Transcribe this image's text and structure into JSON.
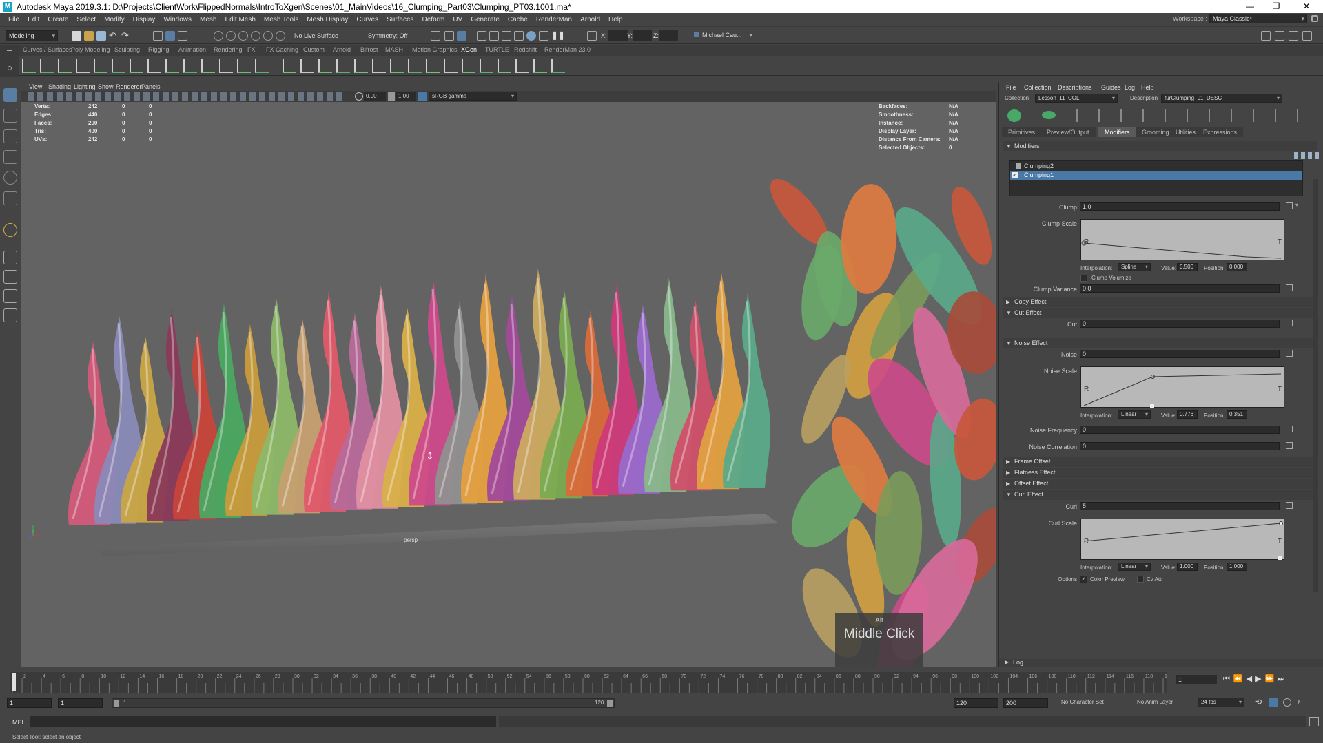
{
  "window": {
    "title": "Autodesk Maya 2019.3.1: D:\\Projects\\ClientWork\\FlippedNormals\\IntroToXgen\\Scenes\\01_MainVideos\\16_Clumping_Part03\\Clumping_PT03.1001.ma*",
    "logo_letter": "M",
    "minimize": "—",
    "maximize": "❐",
    "close": "✕"
  },
  "menubar": [
    "File",
    "Edit",
    "Create",
    "Select",
    "Modify",
    "Display",
    "Windows",
    "Mesh",
    "Edit Mesh",
    "Mesh Tools",
    "Mesh Display",
    "Curves",
    "Surfaces",
    "Deform",
    "UV",
    "Generate",
    "Cache",
    "RenderMan",
    "Arnold",
    "Help"
  ],
  "workspace": {
    "label": "Workspace :",
    "value": "Maya Classic*"
  },
  "statusline": {
    "menuset": "Modeling",
    "live_surface": "No Live Surface",
    "symmetry": "Symmetry: Off",
    "x_label": "X:",
    "y_label": "Y:",
    "z_label": "Z:",
    "user": "Michael Cau..."
  },
  "shelf_tabs": [
    "Curves / Surfaces",
    "Poly Modeling",
    "Sculpting",
    "Rigging",
    "Animation",
    "Rendering",
    "FX",
    "FX Caching",
    "Custom",
    "Arnold",
    "Bifrost",
    "MASH",
    "Motion Graphics",
    "XGen",
    "TURTLE",
    "Redshift",
    "RenderMan 23.0"
  ],
  "shelf_active_tab": "XGen",
  "panel_menu": [
    "View",
    "Shading",
    "Lighting",
    "Show",
    "Renderer",
    "Panels"
  ],
  "panel_tools": {
    "exposure": "0.00",
    "gamma": "1.00",
    "colorspace": "sRGB gamma"
  },
  "hud_left": {
    "rows": [
      {
        "label": "Verts:",
        "v1": "242",
        "v2": "0",
        "v3": "0"
      },
      {
        "label": "Edges:",
        "v1": "440",
        "v2": "0",
        "v3": "0"
      },
      {
        "label": "Faces:",
        "v1": "200",
        "v2": "0",
        "v3": "0"
      },
      {
        "label": "Tris:",
        "v1": "400",
        "v2": "0",
        "v3": "0"
      },
      {
        "label": "UVs:",
        "v1": "242",
        "v2": "0",
        "v3": "0"
      }
    ]
  },
  "hud_right": {
    "rows": [
      {
        "label": "Backfaces:",
        "value": "N/A"
      },
      {
        "label": "Smoothness:",
        "value": "N/A"
      },
      {
        "label": "Instance:",
        "value": "N/A"
      },
      {
        "label": "Display Layer:",
        "value": "N/A"
      },
      {
        "label": "Distance From Camera:",
        "value": "N/A"
      },
      {
        "label": "Selected Objects:",
        "value": "0"
      }
    ]
  },
  "viewport": {
    "camera": "persp"
  },
  "overlay": {
    "modifier": "Alt",
    "action": "Middle Click"
  },
  "xgen": {
    "menu": [
      "File",
      "Collection",
      "Descriptions",
      "Guides",
      "Log",
      "Help"
    ],
    "collection_label": "Collection",
    "collection_value": "Lesson_11_COL",
    "description_label": "Description",
    "description_value": "furClumping_01_DESC",
    "tabs": [
      "Primitives",
      "Preview/Output",
      "Modifiers",
      "Grooming",
      "Utilities",
      "Expressions"
    ],
    "active_tab": "Modifiers",
    "modifiers_header": "Modifiers",
    "modifier_list": [
      "Clumping2",
      "Clumping1"
    ],
    "selected_modifier": "Clumping1",
    "clump": {
      "label": "Clump",
      "value": "1.0"
    },
    "clump_scale": {
      "label": "Clump Scale",
      "interp_label": "Interpolation:",
      "interp": "Spline",
      "value_label": "Value:",
      "value": "0.500",
      "pos_label": "Position:",
      "position": "0.000",
      "r": "R",
      "t": "T"
    },
    "clump_volumize": "Clump Volumize",
    "clump_variance": {
      "label": "Clump Variance",
      "value": "0.0"
    },
    "copy_effect": "Copy Effect",
    "cut_effect": "Cut Effect",
    "cut": {
      "label": "Cut",
      "value": "0"
    },
    "noise_effect": "Noise Effect",
    "noise": {
      "label": "Noise",
      "value": "0"
    },
    "noise_scale": {
      "label": "Noise Scale",
      "interp_label": "Interpolation:",
      "interp": "Linear",
      "value_label": "Value:",
      "value": "0.776",
      "pos_label": "Position:",
      "position": "0.351",
      "r": "R",
      "t": "T"
    },
    "noise_frequency": {
      "label": "Noise Frequency",
      "value": "0"
    },
    "noise_correlation": {
      "label": "Noise Correlation",
      "value": "0"
    },
    "frame_offset": "Frame Offset",
    "flatness_effect": "Flatness Effect",
    "offset_effect": "Offset Effect",
    "curl_effect": "Curl Effect",
    "curl": {
      "label": "Curl",
      "value": "5"
    },
    "curl_scale": {
      "label": "Curl Scale",
      "interp_label": "Interpolation:",
      "interp": "Linear",
      "value_label": "Value:",
      "value": "1.000",
      "pos_label": "Position:",
      "position": "1.000",
      "r": "R",
      "t": "T"
    },
    "options_label": "Options",
    "color_preview": "Color Preview",
    "cv_attr": "Cv Attr",
    "log": "Log"
  },
  "timeline": {
    "ticks": [
      "2",
      "4",
      "6",
      "8",
      "10",
      "12",
      "14",
      "16",
      "18",
      "20",
      "22",
      "24",
      "26",
      "28",
      "30",
      "32",
      "34",
      "36",
      "38",
      "40",
      "42",
      "44",
      "46",
      "48",
      "50",
      "52",
      "54",
      "56",
      "58",
      "60",
      "62",
      "64",
      "66",
      "68",
      "70",
      "72",
      "74",
      "76",
      "78",
      "80",
      "82",
      "84",
      "86",
      "88",
      "90",
      "92",
      "94",
      "96",
      "98",
      "100",
      "102",
      "104",
      "106",
      "108",
      "110",
      "112",
      "114",
      "116",
      "118",
      "120"
    ],
    "current_frame": "1"
  },
  "range": {
    "start": "1",
    "start2": "1",
    "slider_start": "1",
    "slider_end": "120",
    "end": "120",
    "end2": "200",
    "character_set": "No Character Set",
    "anim_layer": "No Anim Layer",
    "fps": "24 fps"
  },
  "cmdline": {
    "mode": "MEL"
  },
  "helpline": {
    "text": "Select Tool: select an object"
  },
  "colors": {
    "accent_select": "#4a79a8",
    "xgen_tab_active": "#5a5a5a",
    "viewport_bg": "#636363"
  }
}
